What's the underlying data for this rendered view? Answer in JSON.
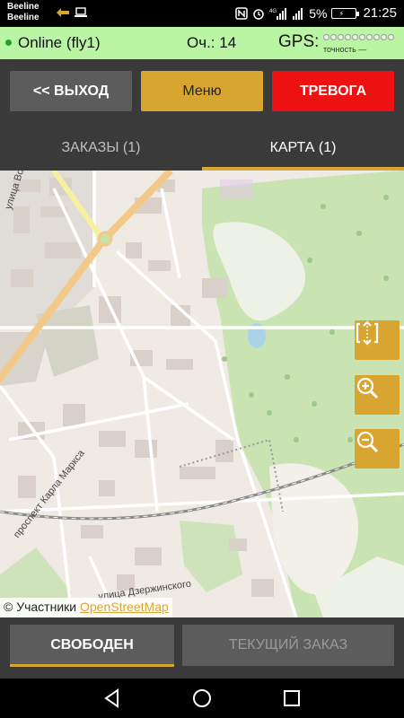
{
  "status_bar": {
    "carrier_1": "Beeline",
    "carrier_2": "Beeline",
    "network_type": "4G",
    "battery_percent": "5%",
    "time": "21:25",
    "icons": [
      "whatsapp-like-icon",
      "laptop-icon",
      "nfc-icon",
      "alarm-icon",
      "signal-icon",
      "wifi-icon",
      "battery-charging-icon"
    ]
  },
  "info_bar": {
    "status": "Online (fly1)",
    "score": "Оч.: 14",
    "gps_label": "GPS:",
    "gps_accuracy": "точность —",
    "gps_signal_dots": 10
  },
  "actions": {
    "exit": "<< ВЫХОД",
    "menu": "Меню",
    "alarm": "ТРЕВОГА"
  },
  "tabs": [
    {
      "label": "ЗАКАЗЫ (1)",
      "active": false
    },
    {
      "label": "КАРТА (1)",
      "active": true
    }
  ],
  "map": {
    "street_1": "улица Воро",
    "street_2": "проспект Карла Маркса",
    "street_3": "улица Дзержинского",
    "attribution_prefix": "© Участники",
    "attribution_link": "OpenStreetMap",
    "controls": [
      "fit-bounds-icon",
      "zoom-in-icon",
      "zoom-out-icon"
    ]
  },
  "bottom": {
    "free": "СВОБОДЕН",
    "current_order": "ТЕКУЩИЙ ЗАКАЗ"
  },
  "colors": {
    "accent": "#d9a531",
    "alarm": "#ee1111",
    "online_bar": "#b9f5a2",
    "panel": "#3a3a3a",
    "button": "#5c5c5c"
  }
}
